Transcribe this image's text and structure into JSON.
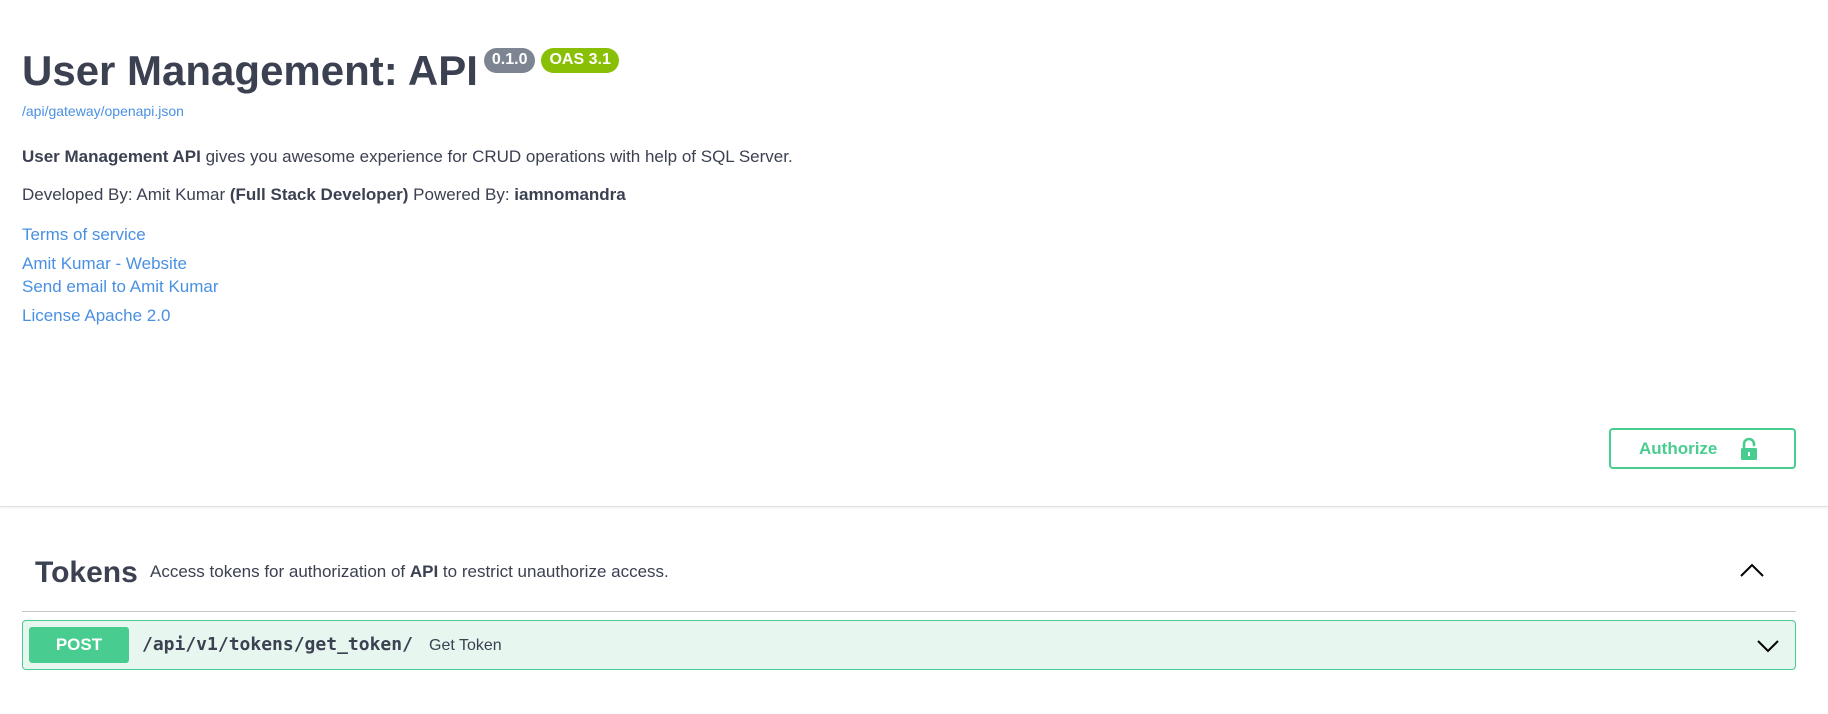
{
  "info": {
    "title": "User Management: API",
    "version_badge": "0.1.0",
    "oas_badge": "OAS 3.1",
    "spec_url": "/api/gateway/openapi.json",
    "description_line1": {
      "bold": "User Management API",
      "rest": " gives you awesome experience for CRUD operations with help of SQL Server."
    },
    "description_line2": {
      "developed_by_prefix": "Developed By: Amit Kumar ",
      "developer_role": "(Full Stack Developer)",
      "powered_by_prefix": " Powered By: ",
      "powered_by": "iamnomandra"
    },
    "links": {
      "terms": "Terms of service",
      "website": "Amit Kumar - Website",
      "email": "Send email to Amit Kumar",
      "license": "License Apache 2.0"
    }
  },
  "authorize": {
    "label": "Authorize",
    "icon": "lock-icon"
  },
  "tag": {
    "name": "Tokens",
    "description_prefix": "Access tokens for authorization of ",
    "description_bold": "API",
    "description_suffix": " to restrict unauthorize access.",
    "toggle_icon": "chevron-up-icon",
    "operations": [
      {
        "method": "POST",
        "path": "/api/v1/tokens/get_token/",
        "summary": "Get Token",
        "toggle_icon": "chevron-down-icon"
      }
    ]
  },
  "colors": {
    "text": "#3b4151",
    "link": "#4990e2",
    "post": "#49cc90",
    "post_bg": "#e8f6f0",
    "version_badge": "#7d8492",
    "oas_badge": "#89bf04"
  }
}
